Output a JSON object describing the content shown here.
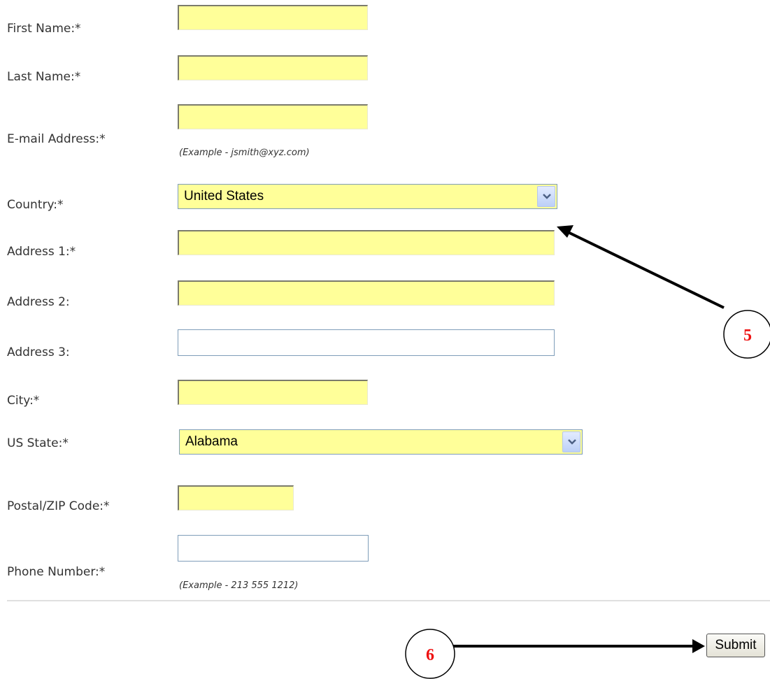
{
  "form": {
    "first_name": {
      "label": "First Name:*",
      "value": ""
    },
    "last_name": {
      "label": "Last Name:*",
      "value": ""
    },
    "email": {
      "label": "E-mail Address:*",
      "value": "",
      "hint": "(Example - jsmith@xyz.com)"
    },
    "country": {
      "label": "Country:*",
      "selected": "United States"
    },
    "address1": {
      "label": "Address 1:*",
      "value": ""
    },
    "address2": {
      "label": "Address 2:",
      "value": ""
    },
    "address3": {
      "label": "Address 3:",
      "value": ""
    },
    "city": {
      "label": "City:*",
      "value": ""
    },
    "us_state": {
      "label": "US State:*",
      "selected": "Alabama"
    },
    "postal": {
      "label": "Postal/ZIP Code:*",
      "value": ""
    },
    "phone": {
      "label": "Phone Number:*",
      "value": "",
      "hint": "(Example - 213 555 1212)"
    }
  },
  "actions": {
    "submit_label": "Submit"
  },
  "annotations": {
    "callout_5": "5",
    "callout_6": "6"
  },
  "colors": {
    "required_field_bg": "#ffff99",
    "optional_field_border": "#7f9db9",
    "callout_number": "#ee1111"
  }
}
